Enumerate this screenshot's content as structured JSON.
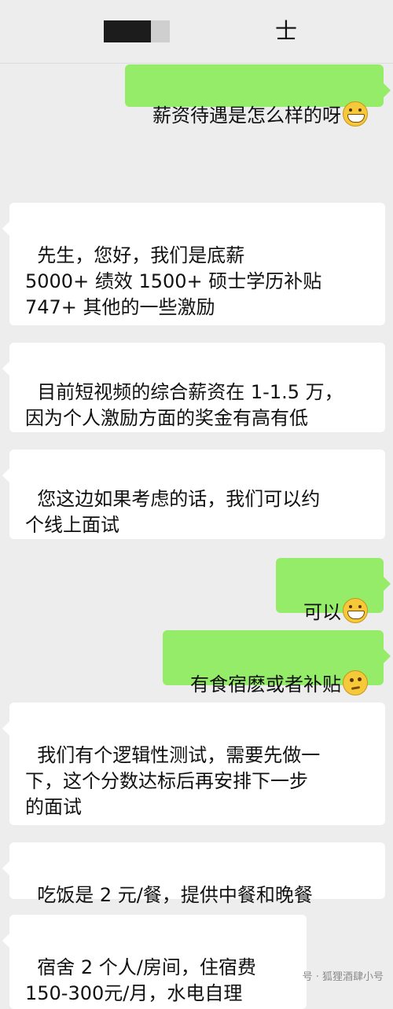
{
  "header": {
    "title": "士"
  },
  "messages": [
    {
      "side": "right",
      "text": "薪资待遇是怎么样的呀",
      "emoji": "grin-icon"
    },
    {
      "side": "left",
      "text": "先生，您好，我们是底薪\n5000+ 绩效 1500+ 硕士学历补贴\n747+ 其他的一些激励"
    },
    {
      "side": "left",
      "text": "目前短视频的综合薪资在 1-1.5 万，\n因为个人激励方面的奖金有高有低"
    },
    {
      "side": "left",
      "text": "您这边如果考虑的话，我们可以约\n个线上面试"
    },
    {
      "side": "right",
      "text": "可以",
      "emoji": "grin-icon"
    },
    {
      "side": "right",
      "text": "有食宿麽或者补贴",
      "emoji": "thinking-icon"
    },
    {
      "side": "left",
      "text": "我们有个逻辑性测试，需要先做一\n下，这个分数达标后再安排下一步\n的面试"
    },
    {
      "side": "left",
      "text": "吃饭是 2 元/餐，提供中餐和晚餐"
    },
    {
      "side": "left",
      "text": "宿舍 2 个人/房间，住宿费\n150-300元/月，水电自理"
    }
  ],
  "watermark": "号 · 狐狸酒肆小号",
  "colors": {
    "background": "#ededed",
    "self_bubble": "#95ec69",
    "other_bubble": "#ffffff"
  }
}
